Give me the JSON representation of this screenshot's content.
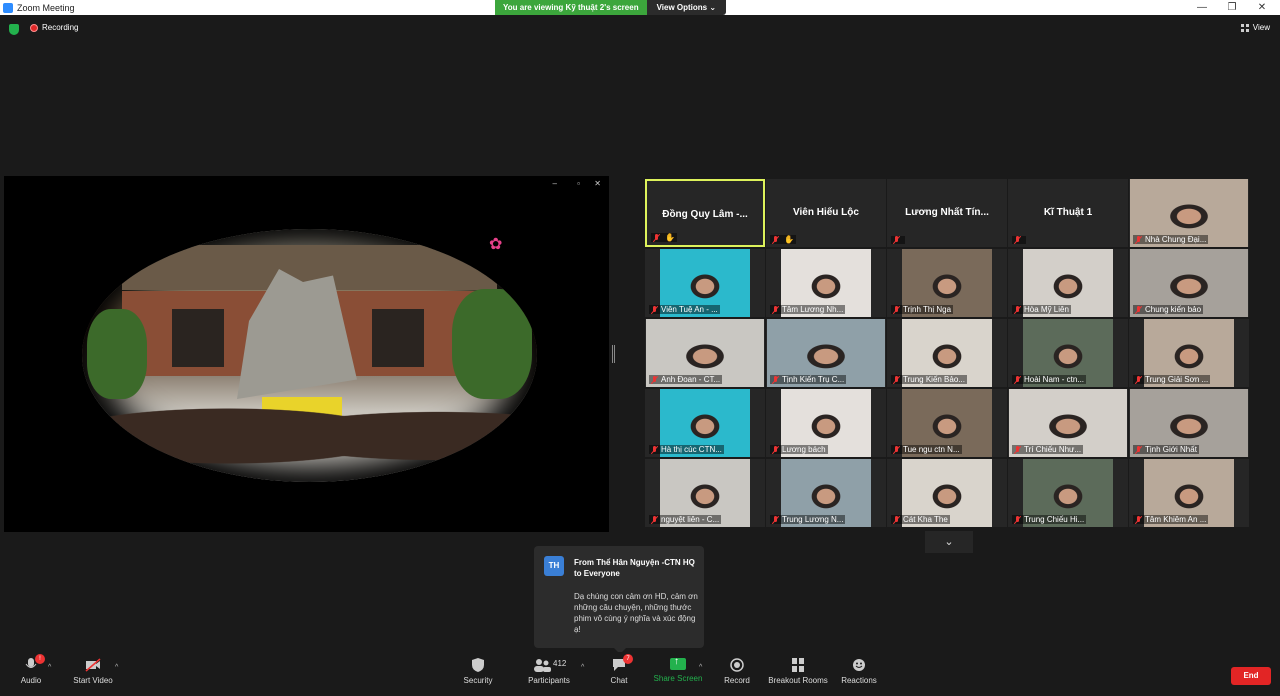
{
  "window": {
    "title": "Zoom Meeting"
  },
  "share_banner": {
    "text": "You are viewing Kỹ thuật 2's screen",
    "options_label": "View Options ⌄"
  },
  "topbar": {
    "recording_label": "Recording",
    "view_label": "View"
  },
  "gallery": {
    "tiles": [
      {
        "name": "Đồng Quy Lâm -...",
        "video": false,
        "active": true,
        "pinned": true
      },
      {
        "name": "Viên Hiếu Lộc",
        "video": false,
        "pinned": true
      },
      {
        "name": "Lương Nhất Tín...",
        "video": false
      },
      {
        "name": "Kĩ Thuật 1",
        "video": false
      },
      {
        "name": "Nhà Chung Đại...",
        "video": true
      },
      {
        "name": "Viên Tuệ An - ...",
        "video": true
      },
      {
        "name": "Tâm Lương Nh...",
        "video": true
      },
      {
        "name": "Trịnh Thị Nga",
        "video": true
      },
      {
        "name": "Hòa Mỹ Liên",
        "video": true
      },
      {
        "name": "Chung kiến bảo",
        "video": true
      },
      {
        "name": "Anh Đoan - CT...",
        "video": true
      },
      {
        "name": "Tịnh Kiến Trụ C...",
        "video": true
      },
      {
        "name": "Trung Kiến Bảo...",
        "video": true
      },
      {
        "name": "Hoài Nam - ctn...",
        "video": true
      },
      {
        "name": "Trung Giải Sơn ...",
        "video": true
      },
      {
        "name": "Hà thị cúc CTN...",
        "video": true
      },
      {
        "name": "Lương bách",
        "video": true
      },
      {
        "name": "Tue ngu ctn N...",
        "video": true
      },
      {
        "name": "Trí Chiếu Như...",
        "video": true
      },
      {
        "name": "Tịnh Giới Nhất",
        "video": true
      },
      {
        "name": "nguyệt liên - C...",
        "video": true
      },
      {
        "name": "Trung Lương N...",
        "video": true
      },
      {
        "name": "Cát Kha The",
        "video": true
      },
      {
        "name": "Trung Chiếu Hi...",
        "video": true
      },
      {
        "name": "Tâm Khiêm An ...",
        "video": true
      }
    ],
    "more_label": "⌄"
  },
  "chat_popup": {
    "avatar": "TH",
    "from": "From Thể Hân Nguyện -CTN HQ to Everyone",
    "message": "Dạ chúng con cảm ơn HD, cảm ơn những câu chuyện, những thước phim vô cùng ý nghĩa và xúc động ạ!"
  },
  "toolbar": {
    "audio": "Audio",
    "audio_badge": "!",
    "video": "Start Video",
    "security": "Security",
    "participants": "Participants",
    "participants_count": "412",
    "chat": "Chat",
    "chat_badge": "7",
    "share": "Share Screen",
    "record": "Record",
    "breakout": "Breakout Rooms",
    "reactions": "Reactions",
    "end": "End"
  },
  "colors": {
    "accent_green": "#23b14d",
    "active_speaker": "#ddf25b",
    "end_red": "#e22525"
  }
}
